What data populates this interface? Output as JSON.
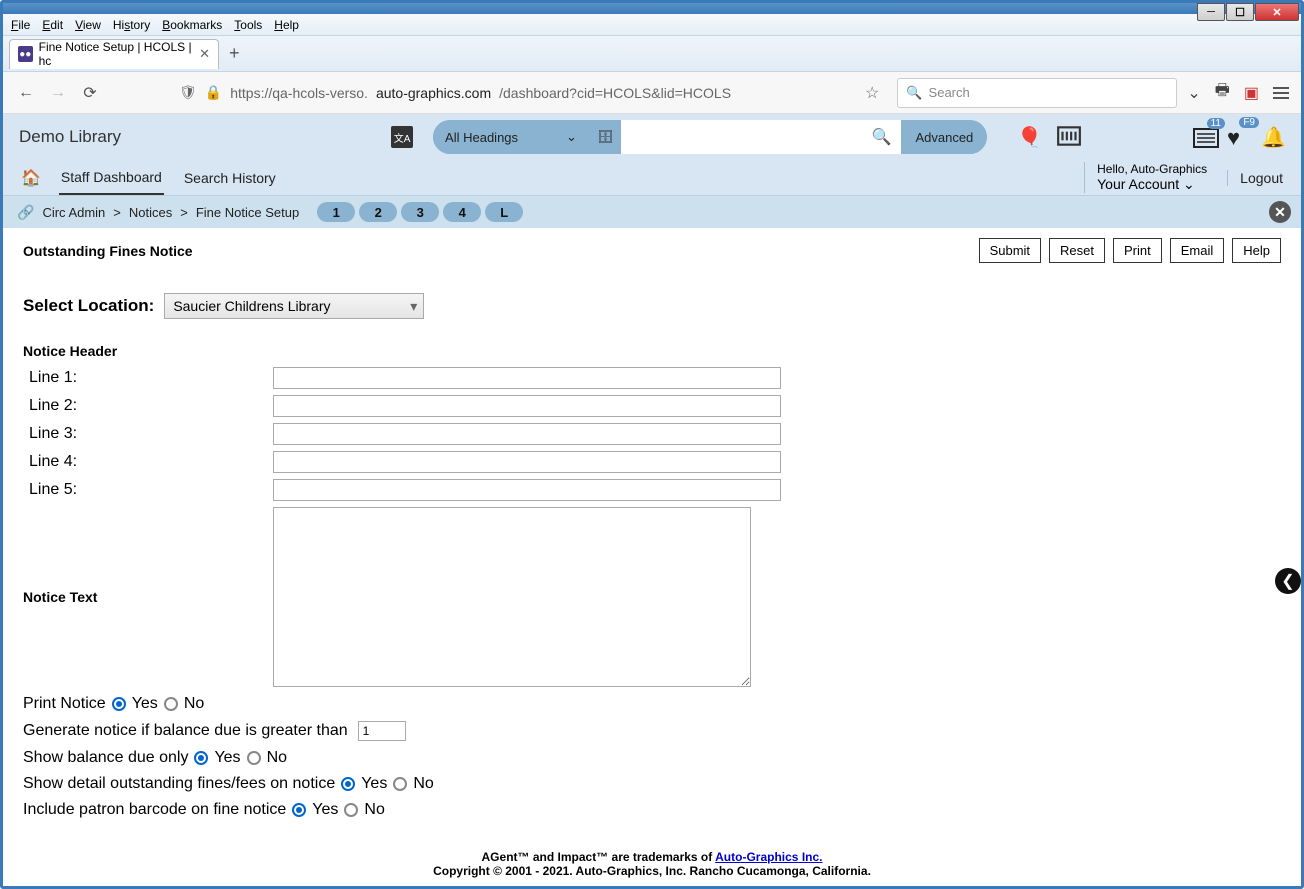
{
  "menubar": [
    "File",
    "Edit",
    "View",
    "History",
    "Bookmarks",
    "Tools",
    "Help"
  ],
  "tab": {
    "title": "Fine Notice Setup | HCOLS | hc"
  },
  "url": {
    "prefix": "https://qa-hcols-verso.",
    "domain": "auto-graphics.com",
    "suffix": "/dashboard?cid=HCOLS&lid=HCOLS"
  },
  "browser_search": {
    "placeholder": "Search"
  },
  "app": {
    "library_name": "Demo Library",
    "headings": "All Headings",
    "advanced": "Advanced",
    "badge_forms": "11",
    "badge_heart": "F9",
    "hello": "Hello, Auto-Graphics",
    "your_account": "Your Account",
    "logout": "Logout"
  },
  "nav": {
    "staff_dashboard": "Staff Dashboard",
    "search_history": "Search History"
  },
  "breadcrumb": {
    "a": "Circ Admin",
    "b": "Notices",
    "c": "Fine Notice Setup",
    "steps": [
      "1",
      "2",
      "3",
      "4",
      "L"
    ]
  },
  "page": {
    "title": "Outstanding Fines Notice",
    "buttons": {
      "submit": "Submit",
      "reset": "Reset",
      "print": "Print",
      "email": "Email",
      "help": "Help"
    },
    "select_location_label": "Select Location:",
    "location": "Saucier Childrens Library",
    "notice_header_label": "Notice Header",
    "lines": {
      "l1": "Line 1:",
      "l2": "Line 2:",
      "l3": "Line 3:",
      "l4": "Line 4:",
      "l5": "Line 5:"
    },
    "notice_text_label": "Notice Text",
    "print_notice_label": "Print Notice",
    "generate_label": "Generate notice if balance due is greater than",
    "generate_value": "1",
    "balance_only_label": "Show balance due only",
    "detail_label": "Show detail outstanding fines/fees on notice",
    "barcode_label": "Include patron barcode on fine notice",
    "yes": "Yes",
    "no": "No"
  },
  "footer": {
    "line1a": "AGent™ and Impact™ are trademarks of ",
    "line1b": "Auto-Graphics Inc.",
    "line2": "Copyright © 2001 - 2021. Auto-Graphics, Inc. Rancho Cucamonga, California."
  }
}
